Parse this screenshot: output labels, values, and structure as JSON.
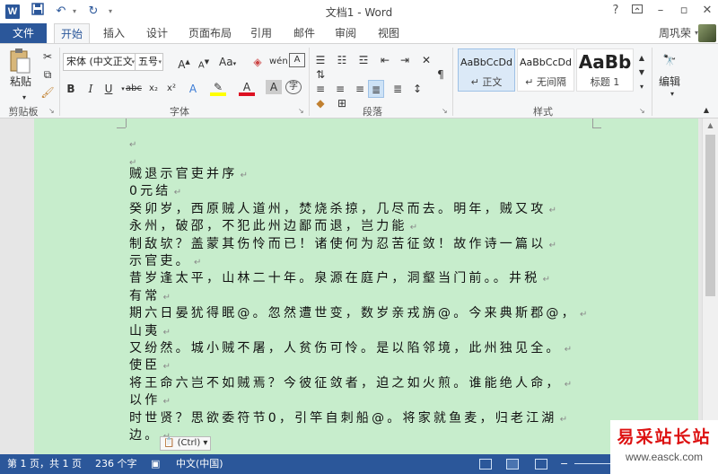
{
  "titlebar": {
    "app_icon": "W",
    "title": "文档1 - Word",
    "help": "?",
    "icons": [
      "save-icon",
      "undo-icon",
      "redo-icon",
      "customize-qat-icon",
      "ribbon-display-icon",
      "minimize-icon",
      "restore-icon",
      "close-icon"
    ]
  },
  "tabs": {
    "file": "文件",
    "items": [
      "开始",
      "插入",
      "设计",
      "页面布局",
      "引用",
      "邮件",
      "审阅",
      "视图"
    ],
    "user": "周巩荣"
  },
  "ribbon": {
    "clipboard": {
      "paste": "粘贴",
      "label": "剪贴板"
    },
    "font": {
      "font_name": "宋体 (中文正文",
      "font_size": "五号",
      "grow": "A",
      "shrink": "A",
      "case": "Aa",
      "bold": "B",
      "italic": "I",
      "underline": "U",
      "strikethrough": "abc",
      "subscript": "x₂",
      "superscript": "x²",
      "label": "字体"
    },
    "paragraph": {
      "label": "段落"
    },
    "styles": {
      "items": [
        {
          "sample": "AaBbCcDd",
          "name": "正文",
          "selected": true
        },
        {
          "sample": "AaBbCcDd",
          "name": "无间隔",
          "selected": false
        },
        {
          "sample": "AaBb",
          "name": "标题 1",
          "selected": false
        }
      ],
      "label": "样式"
    },
    "editing": {
      "label": "编辑"
    }
  },
  "document": {
    "page_color": "#c7edcc",
    "lines": [
      "",
      "",
      "贼退示官吏并序",
      "0元结",
      "癸卯岁，西原贼人道州，焚烧杀掠，几尽而去。明年，贼又攻",
      "永州，破邵，不犯此州边鄙而退，岂力能",
      "制敌欤？盖蒙其伤怜而已！诸使何为忍苦征敛！故作诗一篇以",
      "示官吏。",
      "昔岁逢太平，山林二十年。泉源在庭户，洞壑当门前。。井税",
      "有常",
      "期六日晏犹得眠@。忽然遭世变，数岁亲戎旃@。今来典斯郡@，",
      "山夷",
      "又纷然。城小贼不屠，人贫伤可怜。是以陷邻境，此州独见全。",
      "使臣",
      "将王命六岂不如贼焉？今彼征敛者，迫之如火煎。谁能绝人命，",
      "以作",
      "时世贤？思欲委符节0，引竿自刺船@。将家就鱼麦，归老江湖",
      "边。"
    ],
    "paste_options": "(Ctrl)"
  },
  "statusbar": {
    "page": "第 1 页，共 1 页",
    "words": "236 个字",
    "language": "中文(中国)"
  },
  "watermark": {
    "title": "易采站长站",
    "url": "www.easck.com"
  }
}
